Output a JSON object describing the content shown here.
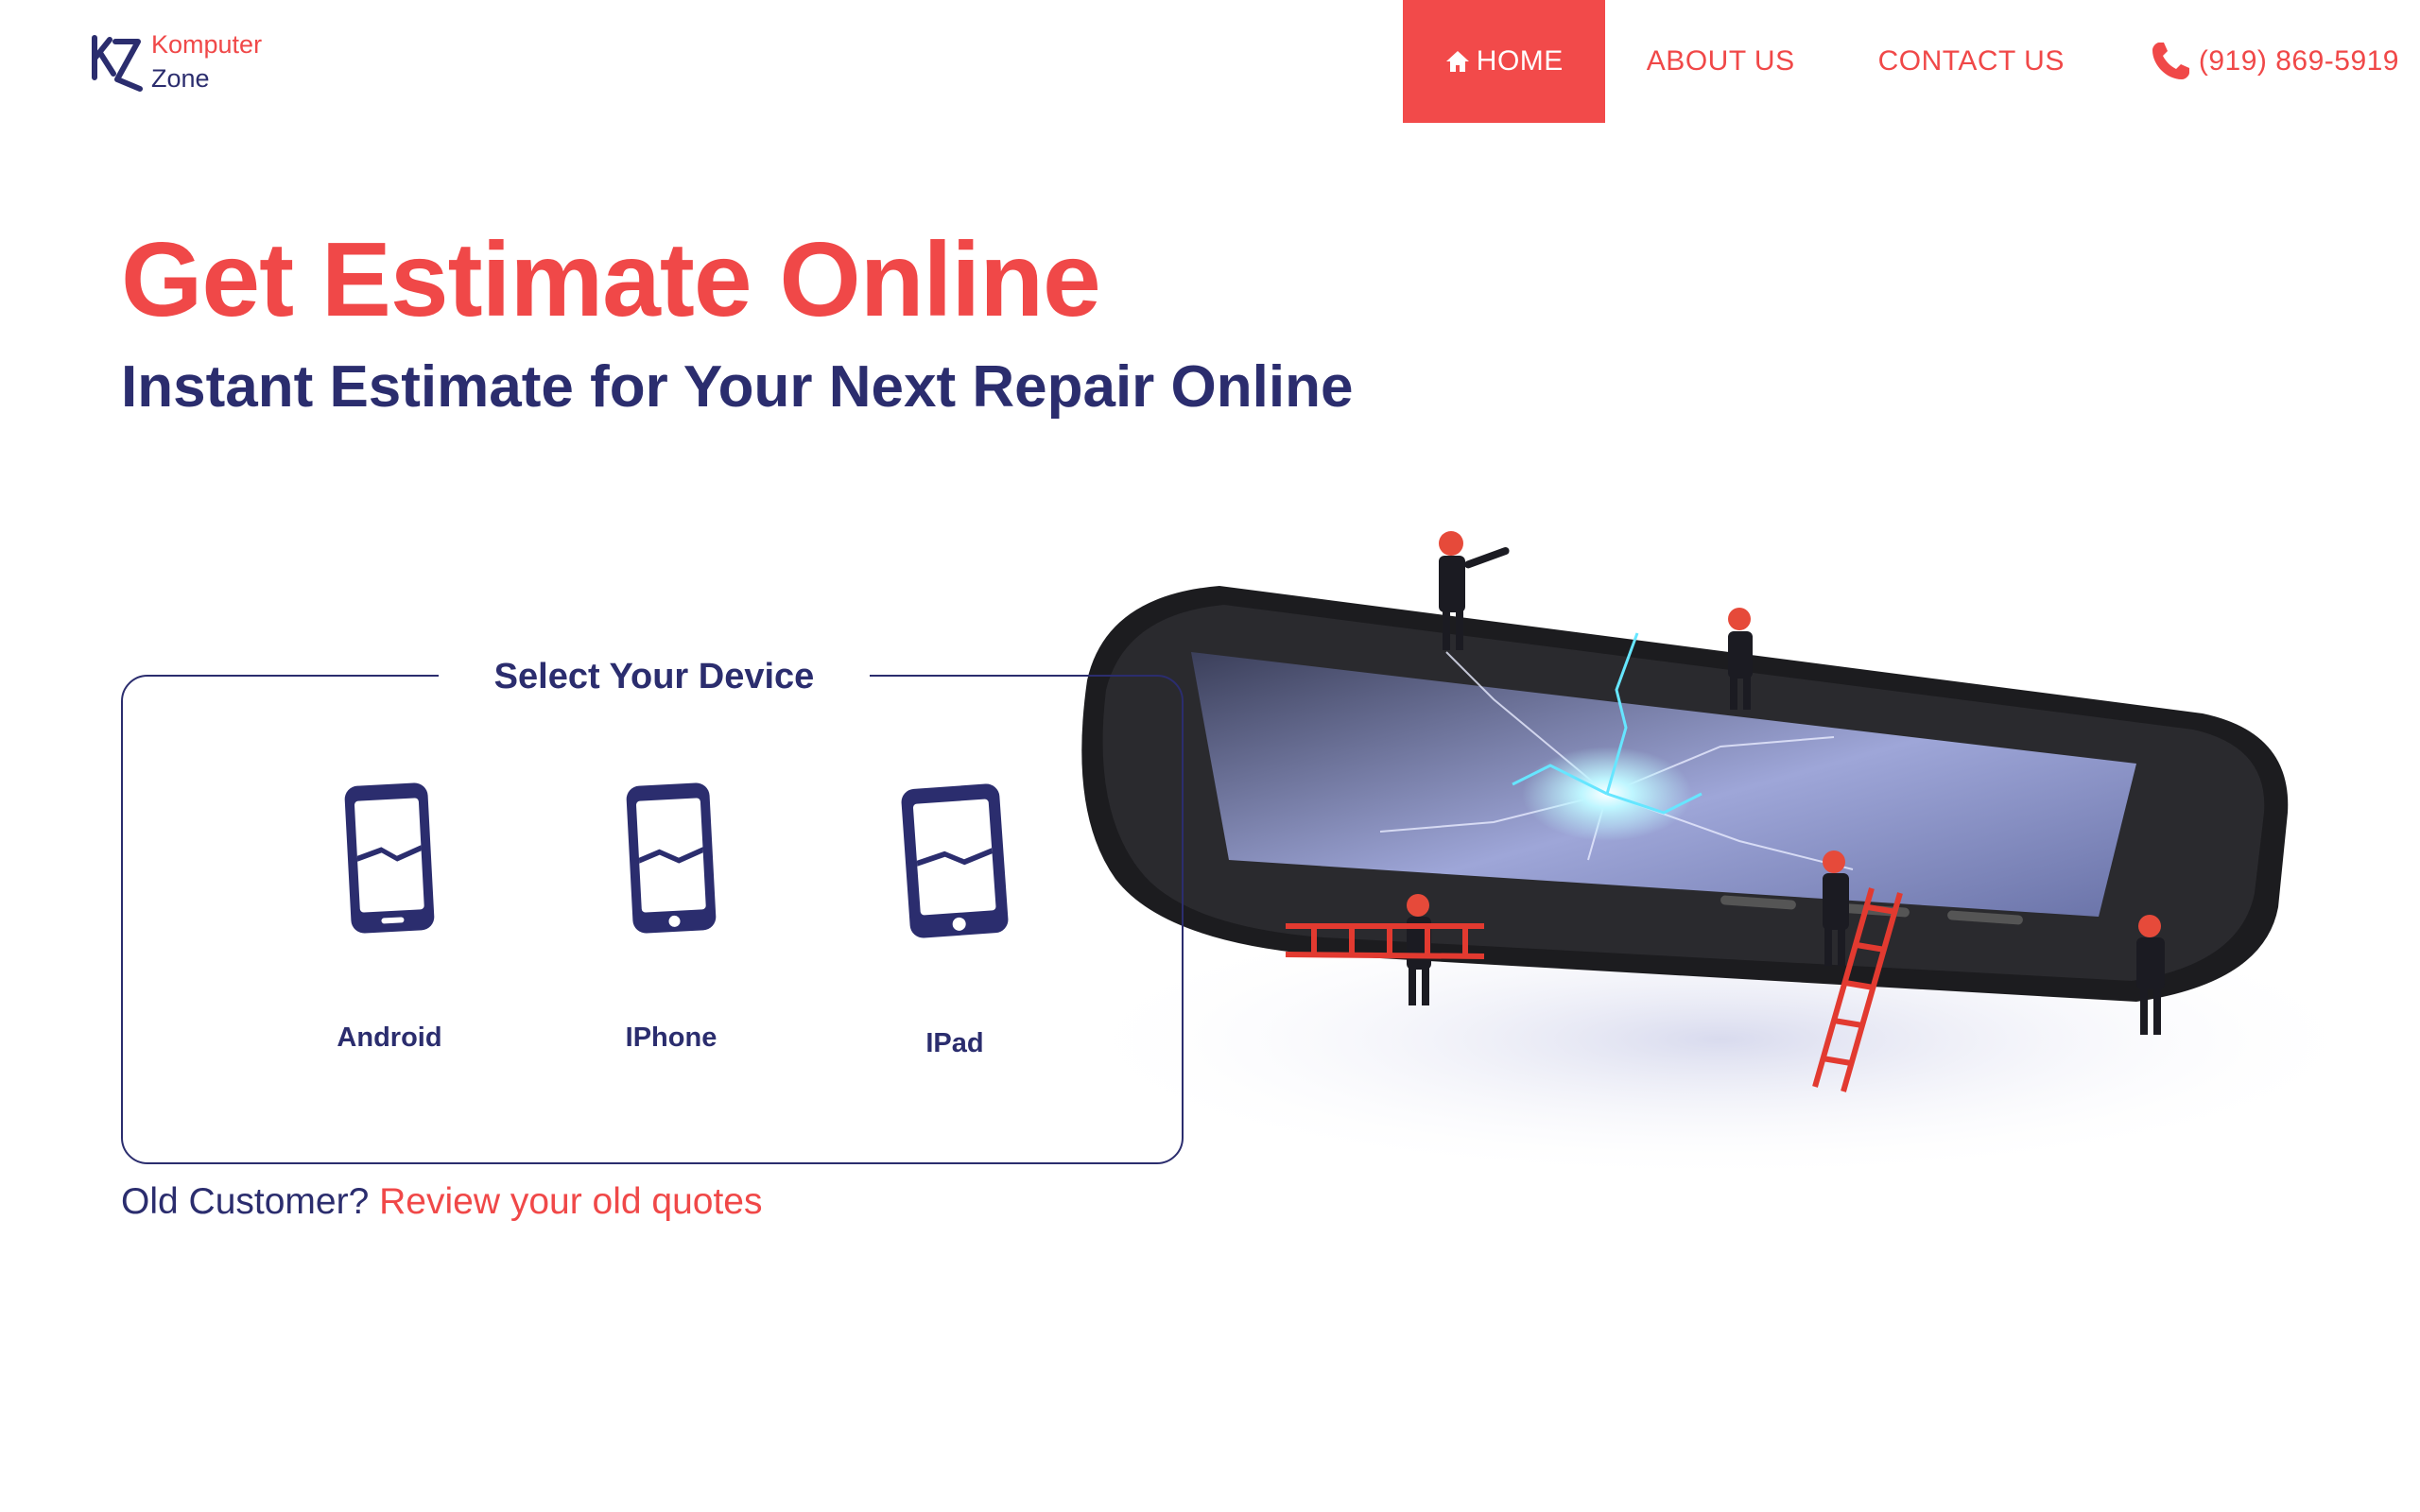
{
  "brand": {
    "name_line1": "Komputer",
    "name_line2": "Zone",
    "mark_icon": "kz-logo-icon"
  },
  "nav": {
    "items": [
      {
        "label": "HOME",
        "icon": "home-icon",
        "active": true
      },
      {
        "label": "ABOUT US",
        "active": false
      },
      {
        "label": "CONTACT US",
        "active": false
      }
    ],
    "phone": {
      "label": "(919) 869-5919",
      "icon": "phone-icon"
    }
  },
  "hero": {
    "title": "Get Estimate Online",
    "subtitle": "Instant Estimate for Your Next Repair Online"
  },
  "selector": {
    "legend": "Select Your Device",
    "devices": [
      {
        "label": "Android",
        "icon": "broken-android-phone-icon"
      },
      {
        "label": "IPhone",
        "icon": "broken-iphone-icon"
      },
      {
        "label": "IPad",
        "icon": "broken-ipad-icon"
      }
    ]
  },
  "old_customer": {
    "prefix": "Old Customer? ",
    "link": "Review your old quotes"
  },
  "colors": {
    "accent": "#f24a4a",
    "navy": "#2b2d6e",
    "background": "#ffffff"
  }
}
